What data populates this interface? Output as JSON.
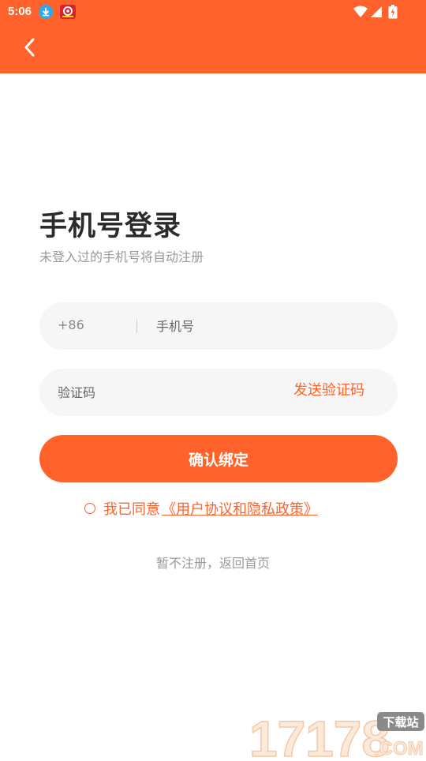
{
  "status_bar": {
    "time": "5:06",
    "notification_icons": [
      "download-icon",
      "app-notification-icon"
    ],
    "system_icons": [
      "wifi-icon",
      "cellular-signal-icon",
      "battery-charging-icon"
    ]
  },
  "header": {
    "back_icon": "chevron-left-icon",
    "background_color": "#ff632b"
  },
  "login": {
    "title": "手机号登录",
    "subtitle": "未登入过的手机号将自动注册",
    "country_code": "+86",
    "phone_placeholder": "手机号",
    "phone_value": "",
    "code_placeholder": "验证码",
    "code_value": "",
    "send_code_label": "发送验证码",
    "confirm_label": "确认绑定",
    "agree_prefix": "我已同意",
    "agree_link": "《用户协议和隐私政策》",
    "agree_checked": false,
    "skip_label": "暂不注册，返回首页"
  },
  "watermark": {
    "number": "17178",
    "suffix": ".COM",
    "badge": "下载站"
  },
  "colors": {
    "accent": "#ff632b",
    "field_bg": "#f6f6f6",
    "muted_text": "#999999"
  }
}
